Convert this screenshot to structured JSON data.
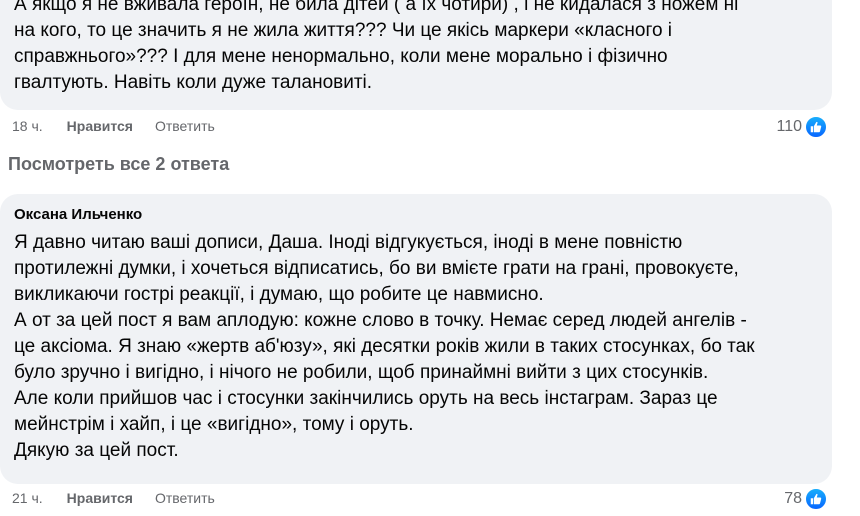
{
  "comments": [
    {
      "lines": [
        "А якщо я не вживала героїн, не била дітей ( а їх чотири) , і не кидалася з ножем ні",
        "на кого, то це значить я не жила життя??? Чи це якісь маркери «класного і",
        "справжнього»??? І для мене ненормально, коли мене морально і фізично",
        "гвалтують. Навіть коли дуже талановиті."
      ],
      "time": "18 ч.",
      "like_label": "Нравится",
      "reply_label": "Ответить",
      "reaction_count": "110",
      "reaction_icon": "thumbs-up-icon"
    },
    {
      "author": "Оксана Ильченко",
      "lines": [
        "Я давно читаю ваші дописи, Даша. Іноді відгукується, іноді в мене повністю",
        "протилежні думки, і хочеться відписатись, бо ви вмієте грати на грані, провокуєте,",
        "викликаючи гострі реакції, і думаю, що робите це навмисно.",
        "А от за цей пост я вам аплодую: кожне слово в точку. Немає серед людей ангелів -",
        "це аксіома. Я знаю «жертв аб'юзу», які десятки років жили в таких стосунках, бо так",
        "було зручно і вигідно, і нічого не робили, щоб принаймні вийти з цих стосунків.",
        "Але коли прийшов час і стосунки закінчились оруть на весь інстаграм. Зараз це",
        "мейнстрім і хайп, і це «вигідно», тому і оруть.",
        "Дякую за цей пост."
      ],
      "time": "21 ч.",
      "like_label": "Нравится",
      "reply_label": "Ответить",
      "reaction_count": "78",
      "reaction_icon": "thumbs-up-icon"
    }
  ],
  "view_replies_label": "Посмотреть все 2 ответа",
  "colors": {
    "bubble": "#f0f2f5",
    "meta_text": "#65676b",
    "like_blue": "#0866ff"
  }
}
